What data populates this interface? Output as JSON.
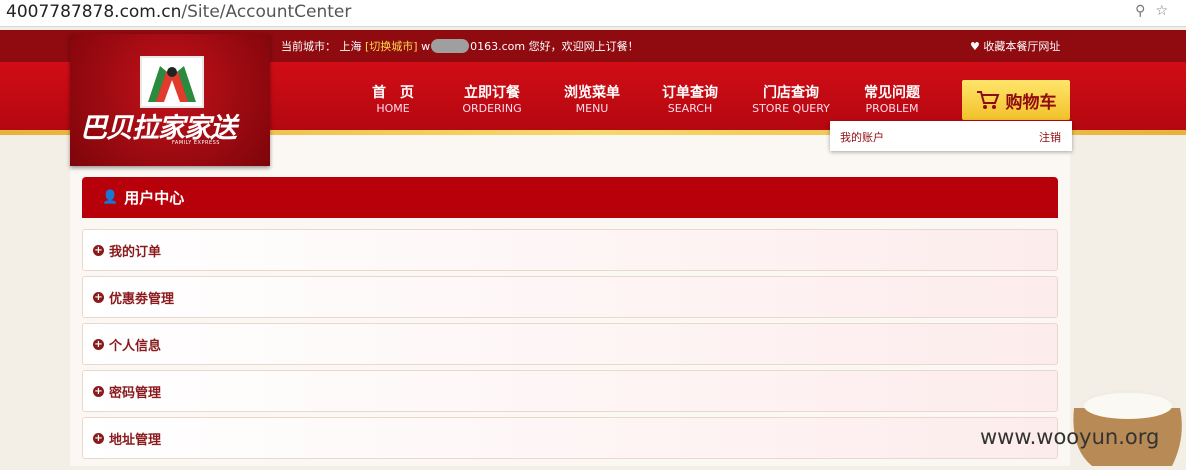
{
  "browser": {
    "url_host": "4007787878.com.cn",
    "url_path": "/Site/AccountCenter"
  },
  "topbar": {
    "city_label": "当前城市：",
    "city": "上海",
    "switch_city": "[切换城市]",
    "user_prefix": "w",
    "user_suffix": "0163.com",
    "greeting": " 您好，欢迎网上订餐！",
    "bookmark": "收藏本餐厅网址"
  },
  "logo": {
    "brand": "巴贝拉家家送",
    "sub": "FAMILY EXPRESS"
  },
  "nav": [
    {
      "cn": "首　页",
      "en": "HOME"
    },
    {
      "cn": "立即订餐",
      "en": "ORDERING"
    },
    {
      "cn": "浏览菜单",
      "en": "MENU"
    },
    {
      "cn": "订单查询",
      "en": "SEARCH"
    },
    {
      "cn": "门店查询",
      "en": "STORE QUERY"
    },
    {
      "cn": "常见问题",
      "en": "PROBLEM"
    }
  ],
  "cart": {
    "label": "购物车",
    "icon": "cart-icon"
  },
  "account_menu": {
    "my_account": "我的账户",
    "logout": "注销"
  },
  "panel": {
    "title": "用户中心",
    "icon": "user-icon",
    "items": [
      "我的订单",
      "优惠劵管理",
      "个人信息",
      "密码管理",
      "地址管理"
    ]
  },
  "watermark": "www.wooyun.org",
  "colors": {
    "brand_red": "#b8000b",
    "dark_red": "#8f0b10",
    "gold": "#f2c12b",
    "accent_yellow": "#ffd94a"
  }
}
